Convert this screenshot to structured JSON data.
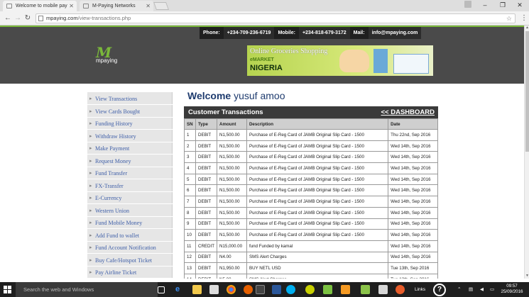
{
  "browser": {
    "tabs": [
      {
        "title": "Welcome to mobile pay",
        "active": true
      },
      {
        "title": "M-Paying Networks",
        "active": false
      }
    ],
    "url_host": "mpaying.com",
    "url_path": "/view-transactions.php"
  },
  "header": {
    "contact": {
      "phone_label": "Phone:",
      "phone": "+234-709-236-6719",
      "mobile_label": "Mobile:",
      "mobile": "+234-818-679-3172",
      "mail_label": "Mail:",
      "mail": "info@mpaying.com"
    },
    "logo_text": "mpaying",
    "banner": {
      "line1": "Online Groceries Shopping",
      "line2": "eMARKET",
      "line3": "NIGERIA"
    },
    "colors": {
      "accent": "#7ab83a",
      "header_bg": "#4a4a4a",
      "title_blue": "#1e3b6e"
    }
  },
  "sidebar": {
    "items": [
      "View Transactions",
      "View Cards Bought",
      "Funding History",
      "Withdraw History",
      "Make Payment",
      "Request Money",
      "Fund Transfer",
      "FX-Transfer",
      "E-Currency",
      "Western Union",
      "Fund Mobile Money",
      "Add Fund to wallet",
      "Fund Account Notification",
      "Buy Cafe/Hotspot Ticket",
      "Pay Airline Ticket"
    ]
  },
  "main": {
    "welcome": "Welcome",
    "user_name": "yusuf amoo",
    "panel_title": "Customer Transactions",
    "dashboard_link": "<< DASHBOARD",
    "columns": [
      "SN",
      "Type",
      "Amount",
      "Description",
      "Date"
    ],
    "rows": [
      [
        "1",
        "DEBIT",
        "N1,500.00",
        "Purchase of E-Reg Card of JAMB Original Slip Card - 1500",
        "Thu 22nd, Sep 2016"
      ],
      [
        "2",
        "DEBIT",
        "N1,500.00",
        "Purchase of E-Reg Card of JAMB Original Slip Card - 1500",
        "Wed 14th, Sep 2016"
      ],
      [
        "3",
        "DEBIT",
        "N1,500.00",
        "Purchase of E-Reg Card of JAMB Original Slip Card - 1500",
        "Wed 14th, Sep 2016"
      ],
      [
        "4",
        "DEBIT",
        "N1,500.00",
        "Purchase of E-Reg Card of JAMB Original Slip Card - 1500",
        "Wed 14th, Sep 2016"
      ],
      [
        "5",
        "DEBIT",
        "N1,500.00",
        "Purchase of E-Reg Card of JAMB Original Slip Card - 1500",
        "Wed 14th, Sep 2016"
      ],
      [
        "6",
        "DEBIT",
        "N1,500.00",
        "Purchase of E-Reg Card of JAMB Original Slip Card - 1500",
        "Wed 14th, Sep 2016"
      ],
      [
        "7",
        "DEBIT",
        "N1,500.00",
        "Purchase of E-Reg Card of JAMB Original Slip Card - 1500",
        "Wed 14th, Sep 2016"
      ],
      [
        "8",
        "DEBIT",
        "N1,500.00",
        "Purchase of E-Reg Card of JAMB Original Slip Card - 1500",
        "Wed 14th, Sep 2016"
      ],
      [
        "9",
        "DEBIT",
        "N1,500.00",
        "Purchase of E-Reg Card of JAMB Original Slip Card - 1500",
        "Wed 14th, Sep 2016"
      ],
      [
        "10",
        "DEBIT",
        "N1,500.00",
        "Purchase of E-Reg Card of JAMB Original Slip Card - 1500",
        "Wed 14th, Sep 2016"
      ],
      [
        "11",
        "CREDIT",
        "N15,000.00",
        "fund Funded by kamal",
        "Wed 14th, Sep 2016"
      ],
      [
        "12",
        "DEBIT",
        "N4.00",
        "SMS Alert Charges",
        "Wed 14th, Sep 2016"
      ],
      [
        "13",
        "DEBIT",
        "N1,950.00",
        "BUY NETL USD",
        "Tue 13th, Sep 2016"
      ],
      [
        "14",
        "DEBIT",
        "N5.00",
        "SMS Alert Charges",
        "Tue 13th, Sep 2016"
      ]
    ]
  },
  "taskbar": {
    "search_placeholder": "Search the web and Windows",
    "links_label": "Links",
    "time": "09:57",
    "date": "25/09/2016"
  }
}
